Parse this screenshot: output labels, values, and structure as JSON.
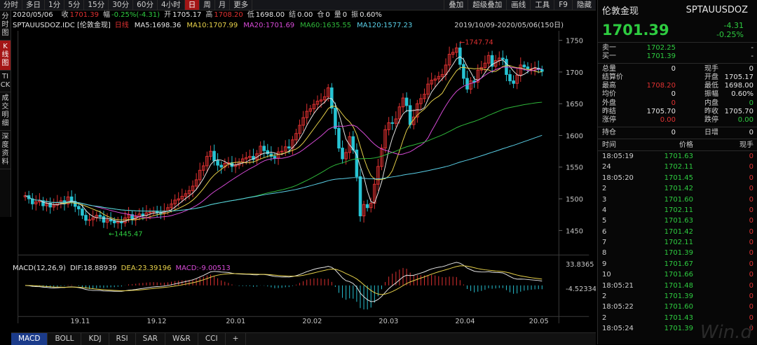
{
  "periods": [
    "分时",
    "多日",
    "1分",
    "5分",
    "15分",
    "30分",
    "60分",
    "4小时",
    "日",
    "周",
    "月",
    "更多"
  ],
  "active_period": "日",
  "toolbar_right": [
    "叠加",
    "超级叠加",
    "画线",
    "工具",
    "F9",
    "隐藏"
  ],
  "sidebar": [
    "分时图",
    "K线图",
    "TICK",
    "成交明细",
    "深度资料"
  ],
  "quote": {
    "date": "2020/05/06",
    "items": [
      {
        "label": "收",
        "value": "1701.39",
        "color": "#e03131"
      },
      {
        "label": "幅",
        "value": "-0.25%(-4.31)",
        "color": "#2ecc40"
      },
      {
        "label": "开",
        "value": "1705.17",
        "color": "#e6e6e6"
      },
      {
        "label": "高",
        "value": "1708.20",
        "color": "#e03131"
      },
      {
        "label": "低",
        "value": "1698.00",
        "color": "#e6e6e6"
      },
      {
        "label": "结",
        "value": "0.00",
        "color": "#e6e6e6"
      },
      {
        "label": "仓",
        "value": "0",
        "color": "#e6e6e6"
      },
      {
        "label": "量",
        "value": "0",
        "color": "#e6e6e6"
      },
      {
        "label": "振",
        "value": "0.60%",
        "color": "#e6e6e6"
      }
    ]
  },
  "ma_legend": {
    "symbol": "SPTAUUSDOZ.IDC [伦敦金现]",
    "period": "日线",
    "items": [
      {
        "label": "MA5:1698.36",
        "color": "#e6e6e6"
      },
      {
        "label": "MA10:1707.99",
        "color": "#e8d24a"
      },
      {
        "label": "MA20:1701.69",
        "color": "#d84bd8"
      },
      {
        "label": "MA60:1635.55",
        "color": "#2fb83a"
      },
      {
        "label": "MA120:1577.23",
        "color": "#5ad0e8"
      }
    ]
  },
  "range_label": "2019/10/09-2020/05/06(150日)",
  "macd_legend": [
    {
      "label": "MACD(12,26,9)",
      "color": "#e6e6e6"
    },
    {
      "label": "DIF:18.88939",
      "color": "#e6e6e6"
    },
    {
      "label": "DEA:23.39196",
      "color": "#e8d24a"
    },
    {
      "label": "MACD:-9.00513",
      "color": "#d84bd8"
    }
  ],
  "bottom_tabs": [
    "MACD",
    "BOLL",
    "KDJ",
    "RSI",
    "SAR",
    "W&R",
    "CCI",
    "+"
  ],
  "right_panel": {
    "name": "伦敦金现",
    "code": "SPTAUUSDOZ",
    "price": "1701.39",
    "change": "-4.31",
    "change_pct": "-0.25%",
    "sell": {
      "label": "卖一",
      "price": "1702.25",
      "vol": "-"
    },
    "buy": {
      "label": "买一",
      "price": "1701.39",
      "vol": "-"
    },
    "stats": [
      {
        "l1": "总量",
        "v1": "0",
        "c1": "#e6e6e6",
        "l2": "现手",
        "v2": "0",
        "c2": "#e6e6e6"
      },
      {
        "l1": "结算价",
        "v1": "",
        "c1": "#e6e6e6",
        "l2": "开盘",
        "v2": "1705.17",
        "c2": "#e6e6e6"
      },
      {
        "l1": "最高",
        "v1": "1708.20",
        "c1": "#e03131",
        "l2": "最低",
        "v2": "1698.00",
        "c2": "#e6e6e6"
      },
      {
        "l1": "均价",
        "v1": "0",
        "c1": "#e6e6e6",
        "l2": "振幅",
        "v2": "0.60%",
        "c2": "#e6e6e6"
      },
      {
        "l1": "外盘",
        "v1": "0",
        "c1": "#e03131",
        "l2": "内盘",
        "v2": "0",
        "c2": "#2ecc40"
      },
      {
        "l1": "昨结",
        "v1": "1705.70",
        "c1": "#e6e6e6",
        "l2": "昨收",
        "v2": "1705.70",
        "c2": "#e6e6e6"
      },
      {
        "l1": "涨停",
        "v1": "0.00",
        "c1": "#e03131",
        "l2": "跌停",
        "v2": "0.00",
        "c2": "#2ecc40"
      },
      {
        "l1": "持仓",
        "v1": "0",
        "c1": "#e6e6e6",
        "l2": "日增",
        "v2": "0",
        "c2": "#e6e6e6"
      }
    ],
    "tick_headers": [
      "时间",
      "价格",
      "现手"
    ],
    "ticks": [
      {
        "t": "18:05:19",
        "p": "1701.63",
        "v": "0"
      },
      {
        "t": "24",
        "p": "1702.11",
        "v": "0"
      },
      {
        "t": "18:05:20",
        "p": "1701.45",
        "v": "0"
      },
      {
        "t": "2",
        "p": "1701.42",
        "v": "0"
      },
      {
        "t": "3",
        "p": "1701.60",
        "v": "0"
      },
      {
        "t": "4",
        "p": "1702.11",
        "v": "0"
      },
      {
        "t": "5",
        "p": "1701.63",
        "v": "0"
      },
      {
        "t": "6",
        "p": "1701.42",
        "v": "0"
      },
      {
        "t": "7",
        "p": "1702.11",
        "v": "0"
      },
      {
        "t": "8",
        "p": "1701.39",
        "v": "0"
      },
      {
        "t": "9",
        "p": "1701.67",
        "v": "0"
      },
      {
        "t": "10",
        "p": "1701.66",
        "v": "0"
      },
      {
        "t": "18:05:21",
        "p": "1701.48",
        "v": "0"
      },
      {
        "t": "2",
        "p": "1701.39",
        "v": "0"
      },
      {
        "t": "18:05:22",
        "p": "1701.60",
        "v": "0"
      },
      {
        "t": "2",
        "p": "1701.43",
        "v": "0"
      },
      {
        "t": "18:05:24",
        "p": "1701.39",
        "v": "0"
      }
    ]
  },
  "chart_data": {
    "type": "candlestick",
    "price_axis_ticks": [
      "1750",
      "1700",
      "1650",
      "1600",
      "1550",
      "1500",
      "1450"
    ],
    "price_range": [
      1420,
      1765
    ],
    "x_labels": [
      "19.11",
      "19.12",
      "20.01",
      "20.02",
      "20.03",
      "20.04",
      "20.05"
    ],
    "high_label": "1747.74",
    "low_label": "1445.47",
    "macd_axis_ticks": [
      "33.8365",
      "-4.52334"
    ],
    "closes": [
      1505,
      1500,
      1492,
      1495,
      1497,
      1489,
      1493,
      1487,
      1490,
      1494,
      1497,
      1492,
      1503,
      1496,
      1488,
      1484,
      1474,
      1466,
      1467,
      1470,
      1474,
      1472,
      1463,
      1467,
      1465,
      1462,
      1464,
      1462,
      1470,
      1475,
      1468,
      1472,
      1476,
      1474,
      1478,
      1479,
      1480,
      1478,
      1477,
      1481,
      1486,
      1492,
      1498,
      1500,
      1504,
      1508,
      1513,
      1520,
      1530,
      1545,
      1552,
      1567,
      1575,
      1560,
      1553,
      1550,
      1556,
      1557,
      1551,
      1553,
      1558,
      1563,
      1565,
      1567,
      1562,
      1571,
      1583,
      1576,
      1571,
      1567,
      1564,
      1574,
      1575,
      1582,
      1580,
      1593,
      1603,
      1616,
      1628,
      1638,
      1642,
      1649,
      1654,
      1656,
      1661,
      1675,
      1643,
      1611,
      1580,
      1563,
      1573,
      1598,
      1577,
      1535,
      1473,
      1491,
      1486,
      1493,
      1523,
      1551,
      1580,
      1609,
      1620,
      1619,
      1626,
      1645,
      1659,
      1647,
      1617,
      1629,
      1650,
      1658,
      1665,
      1681,
      1687,
      1689,
      1693,
      1696,
      1711,
      1728,
      1731,
      1738,
      1712,
      1690,
      1673,
      1686,
      1684,
      1703,
      1707,
      1714,
      1726,
      1709,
      1718,
      1722,
      1720,
      1696,
      1686,
      1682,
      1695,
      1711,
      1708,
      1705,
      1705,
      1706,
      1704,
      1701
    ],
    "series": [
      {
        "name": "MA5",
        "last": 1698.36
      },
      {
        "name": "MA10",
        "last": 1707.99
      },
      {
        "name": "MA20",
        "last": 1701.69
      },
      {
        "name": "MA60",
        "last": 1635.55
      },
      {
        "name": "MA120",
        "last": 1577.23
      }
    ],
    "ma_colors": {
      "MA5": "#e6e6e6",
      "MA10": "#e8d24a",
      "MA20": "#d84bd8",
      "MA60": "#2fb83a",
      "MA120": "#5ad0e8"
    },
    "up_color": "#e03131",
    "down_color": "#27c4d4"
  }
}
